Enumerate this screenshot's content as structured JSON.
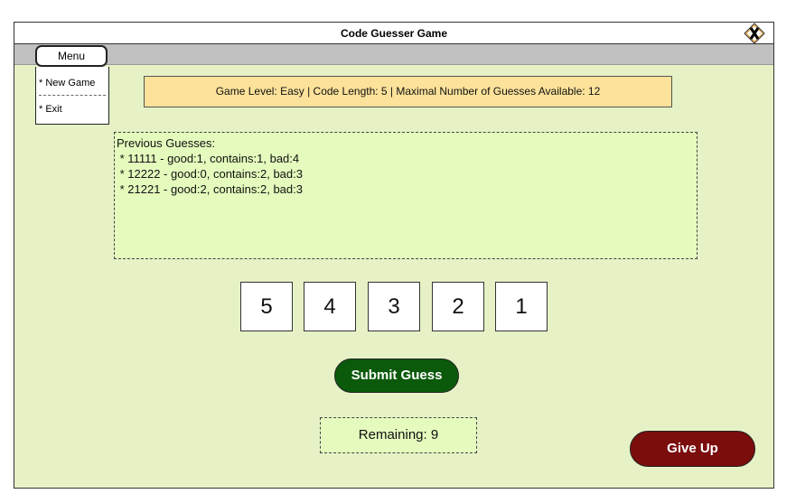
{
  "window": {
    "title": "Code Guesser Game"
  },
  "menu": {
    "button_label": "Menu",
    "items": [
      {
        "label": "* New Game"
      },
      {
        "label": "* Exit"
      }
    ]
  },
  "info": {
    "text": "Game Level: Easy | Code Length: 5 | Maximal  Number of Guesses Available: 12"
  },
  "guesses": {
    "heading": "Previous Guesses:",
    "items": [
      {
        "text": " * 11111 - good:1, contains:1, bad:4"
      },
      {
        "text": " * 12222 - good:0, contains:2, bad:3"
      },
      {
        "text": " * 21221 - good:2, contains:2, bad:3"
      }
    ]
  },
  "code_inputs": [
    {
      "value": "5"
    },
    {
      "value": "4"
    },
    {
      "value": "3"
    },
    {
      "value": "2"
    },
    {
      "value": "1"
    }
  ],
  "actions": {
    "submit_label": "Submit Guess",
    "give_up_label": "Give Up"
  },
  "status": {
    "remaining": "Remaining: 9"
  },
  "colors": {
    "window_background": "#e6f2c6",
    "info_background": "#fce29a",
    "submit_button": "#0b5a0b",
    "give_up_button": "#7b0d0d"
  },
  "icons": {
    "close": "close-icon"
  }
}
